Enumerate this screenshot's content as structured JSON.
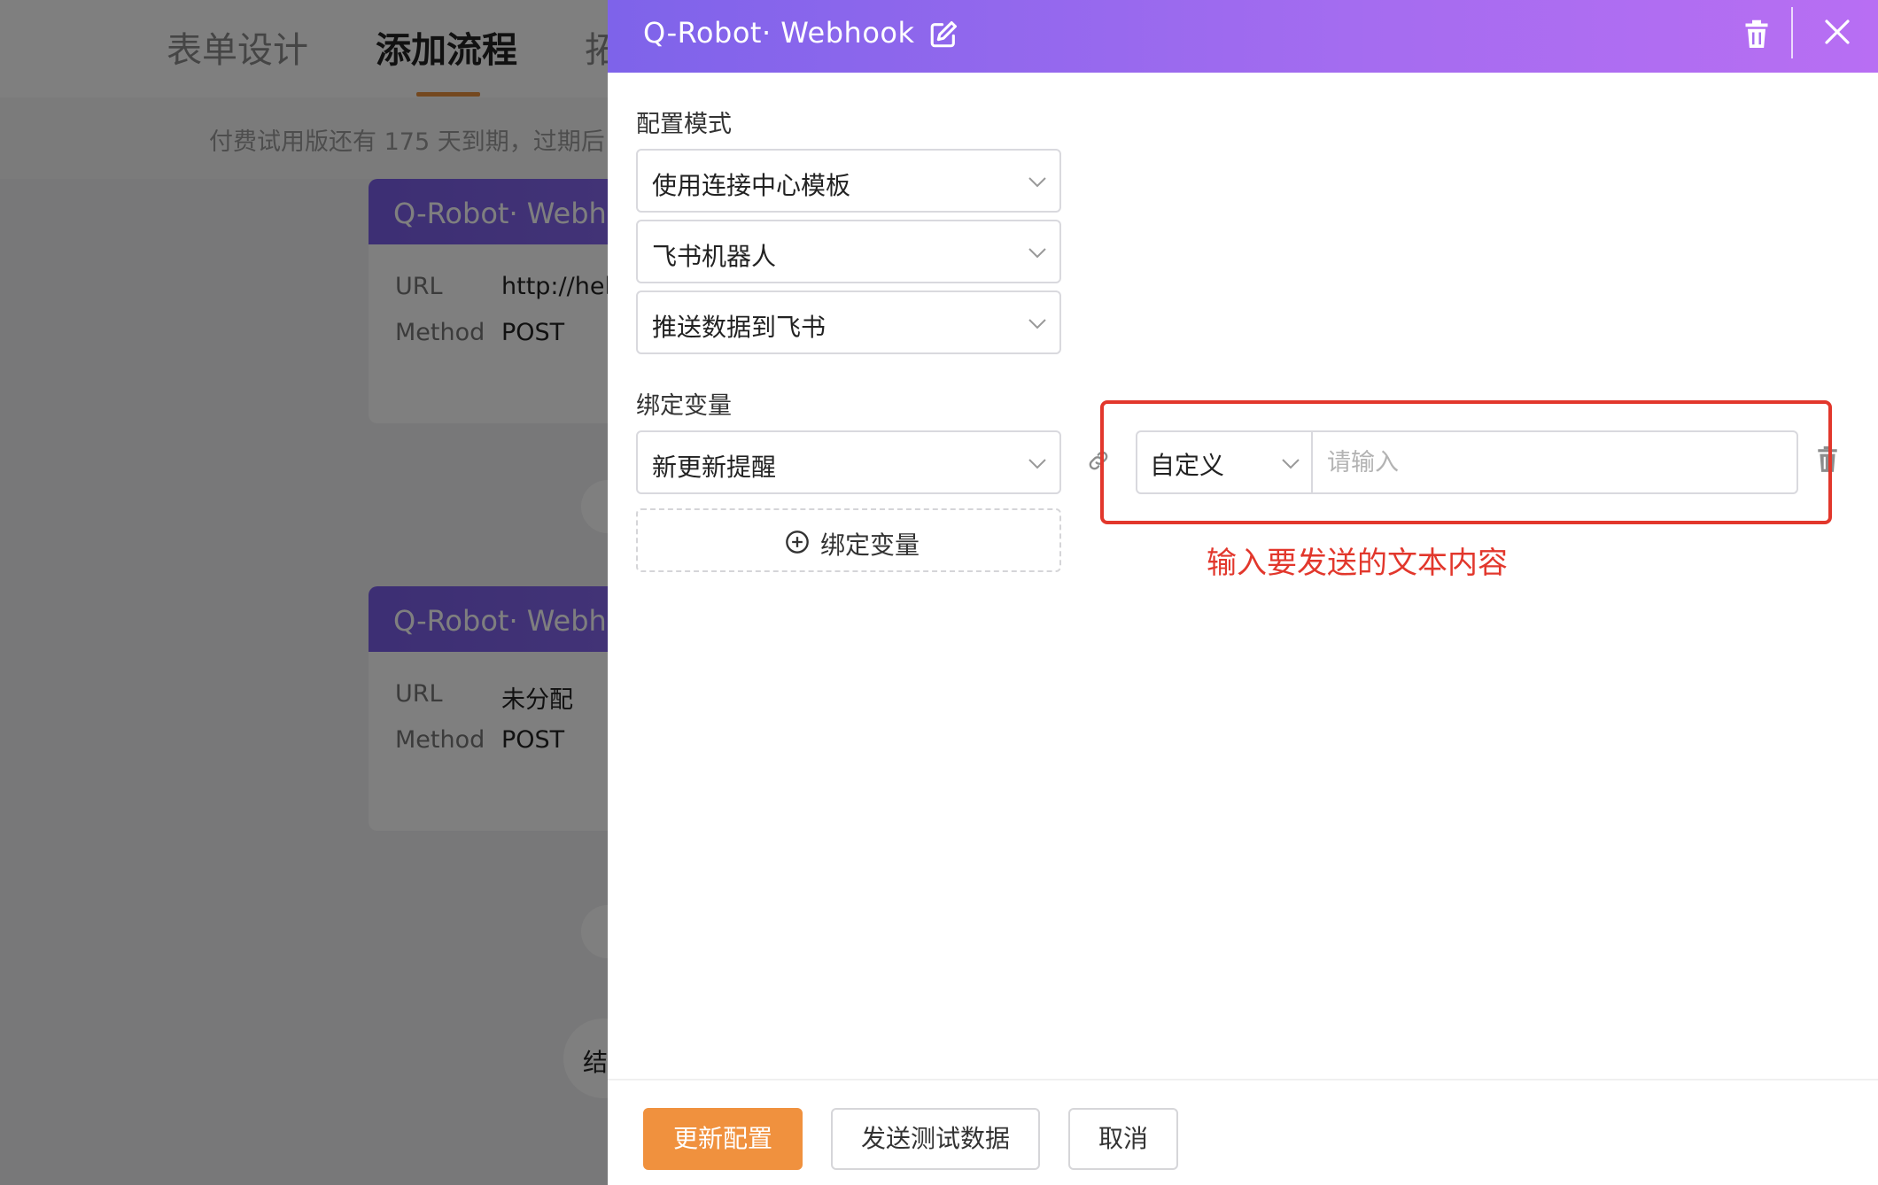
{
  "background": {
    "tabs": [
      "表单设计",
      "添加流程",
      "拓"
    ],
    "active_tab": "添加流程",
    "notice": "付费试用版还有 175 天到期，过期后",
    "cards": [
      {
        "title": "Q-Robot· Webh",
        "url_label": "URL",
        "url_value": "http://hel",
        "method_label": "Method",
        "method_value": "POST"
      },
      {
        "title": "Q-Robot· Webh",
        "url_label": "URL",
        "url_value": "未分配",
        "method_label": "Method",
        "method_value": "POST"
      }
    ],
    "end_node": "结"
  },
  "drawer": {
    "title": "Q-Robot· Webhook",
    "config_mode": {
      "label": "配置模式",
      "selects": [
        "使用连接中心模板",
        "飞书机器人",
        "推送数据到飞书"
      ]
    },
    "bind_vars": {
      "label": "绑定变量",
      "variable_select": "新更新提醒",
      "value_type": "自定义",
      "value_input": "",
      "value_placeholder": "请输入",
      "add_button": "绑定变量"
    },
    "annotation": "输入要发送的文本内容",
    "footer": {
      "update": "更新配置",
      "send_test": "发送测试数据",
      "cancel": "取消"
    }
  },
  "colors": {
    "header_gradient_start": "#7e63ea",
    "header_gradient_end": "#b86ef3",
    "primary_button": "#f0913e",
    "annotation_red": "#e2372c"
  }
}
